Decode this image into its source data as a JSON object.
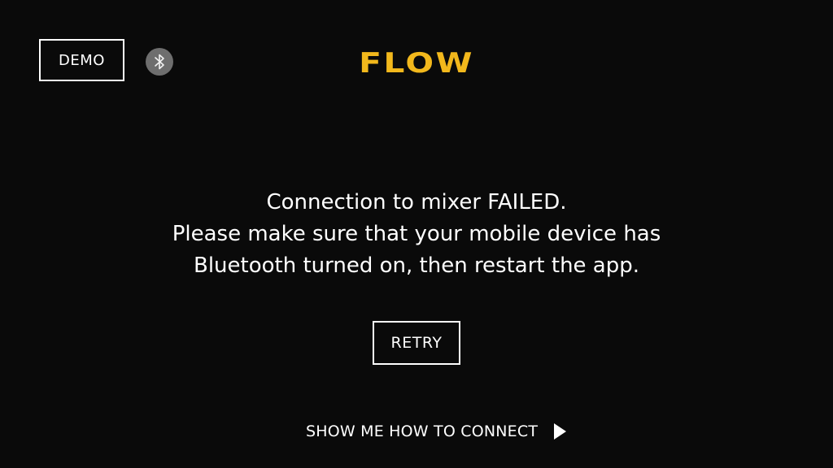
{
  "header": {
    "demo_label": "DEMO",
    "bluetooth_icon": "bluetooth-icon",
    "logo_text": "FLOW"
  },
  "error": {
    "lines": [
      "Connection to mixer FAILED.",
      "Please make sure that your mobile device has",
      "Bluetooth turned on, then restart the app."
    ]
  },
  "actions": {
    "retry_label": "RETRY",
    "howto_label": "SHOW ME HOW TO CONNECT",
    "howto_icon": "play-icon"
  },
  "colors": {
    "background": "#0a0a0a",
    "brand": "#f2b81c",
    "text": "#ffffff",
    "bluetooth_badge": "#6e6e6e"
  }
}
